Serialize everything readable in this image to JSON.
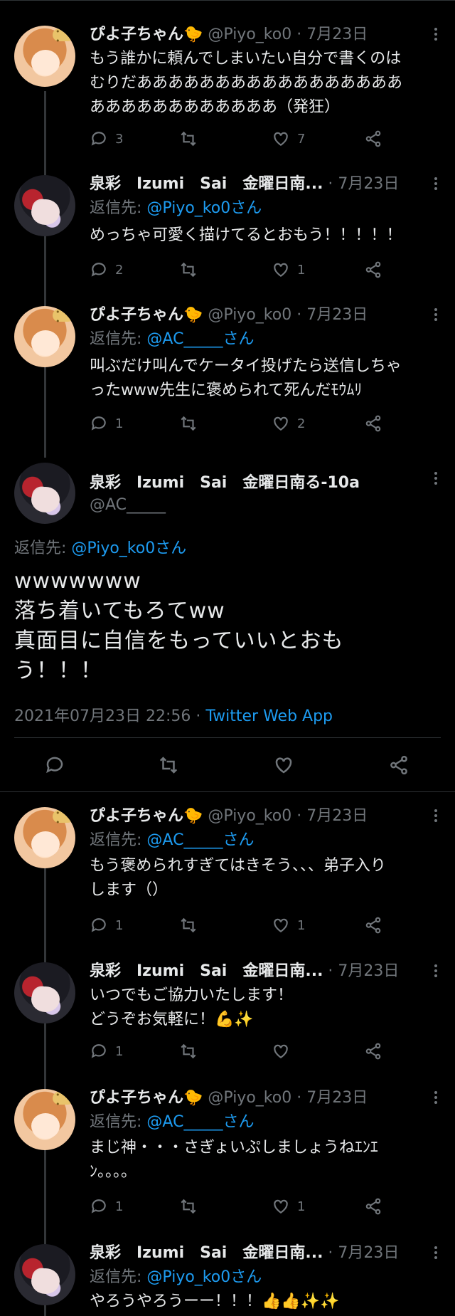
{
  "tweets_before": [
    {
      "avatar": "piyo",
      "name": "ぴよ子ちゃん🐤",
      "handle": "@Piyo_ko0",
      "date": "7月23日",
      "reply_label": "",
      "reply_mention": "",
      "text": "もう誰かに頼んでしまいたい自分で書くのは\nむりだあああああああああああああああああ\nああああああああああああ（発狂）",
      "replies": "3",
      "retweets": "",
      "likes": "7"
    },
    {
      "avatar": "sai",
      "name": "泉彩　Izumi　Sai　金曜日南...",
      "handle": "",
      "date": "7月23日",
      "reply_label": "返信先:",
      "reply_mention": "@Piyo_ko0さん",
      "text": "めっちゃ可愛く描けてるとおもう！！！！！",
      "replies": "2",
      "retweets": "",
      "likes": "1"
    },
    {
      "avatar": "piyo",
      "name": "ぴよ子ちゃん🐤",
      "handle": "@Piyo_ko0",
      "date": "7月23日",
      "reply_label": "返信先:",
      "reply_mention": "@AC_____さん",
      "text": "叫ぶだけ叫んでケータイ投げたら送信しちゃ\nったwww先生に褒められて死んだﾓｳﾑﾘ",
      "replies": "1",
      "retweets": "",
      "likes": "2"
    }
  ],
  "focused": {
    "name": "泉彩　Izumi　Sai　金曜日南る-10a",
    "handle": "@AC_____",
    "reply_label": "返信先:",
    "reply_mention": "@Piyo_ko0さん",
    "text": "wwwwwww\n落ち着いてもろてww\n真面目に自信をもっていいとおも\nう！！！",
    "timestamp": "2021年07月23日 22:56 · ",
    "app": "Twitter Web App"
  },
  "tweets_after": [
    {
      "avatar": "piyo",
      "name": "ぴよ子ちゃん🐤",
      "handle": "@Piyo_ko0",
      "date": "7月23日",
      "reply_label": "返信先:",
      "reply_mention": "@AC_____さん",
      "text": "もう褒められすぎてはきそう、、、弟子入り\nします（）",
      "replies": "1",
      "retweets": "",
      "likes": "1"
    },
    {
      "avatar": "sai",
      "name": "泉彩　Izumi　Sai　金曜日南...",
      "handle": "",
      "date": "7月23日",
      "reply_label": "",
      "reply_mention": "",
      "text": "いつでもご協力いたします！\nどうぞお気軽に！💪✨",
      "replies": "1",
      "retweets": "",
      "likes": ""
    },
    {
      "avatar": "piyo",
      "name": "ぴよ子ちゃん🐤",
      "handle": "@Piyo_ko0",
      "date": "7月23日",
      "reply_label": "返信先:",
      "reply_mention": "@AC_____さん",
      "text": "まじ神・・・さぎょいぷしましょうねｴﾝｴ\nﾝ。。。。",
      "replies": "1",
      "retweets": "",
      "likes": "1"
    },
    {
      "avatar": "sai",
      "name": "泉彩　Izumi　Sai　金曜日南...",
      "handle": "",
      "date": "7月23日",
      "reply_label": "返信先:",
      "reply_mention": "@Piyo_ko0さん",
      "text": "やろうやろうーー！！！👍👍✨✨",
      "replies": "",
      "retweets": "",
      "likes": ""
    }
  ],
  "icons": {
    "reply": "reply-icon",
    "retweet": "retweet-icon",
    "like": "like-icon",
    "share": "share-icon",
    "more": "more-icon"
  },
  "colors": {
    "background": "#000000",
    "text": "#e7e9ea",
    "muted": "#71767b",
    "link": "#1d9bf0",
    "border": "#2f3336"
  }
}
